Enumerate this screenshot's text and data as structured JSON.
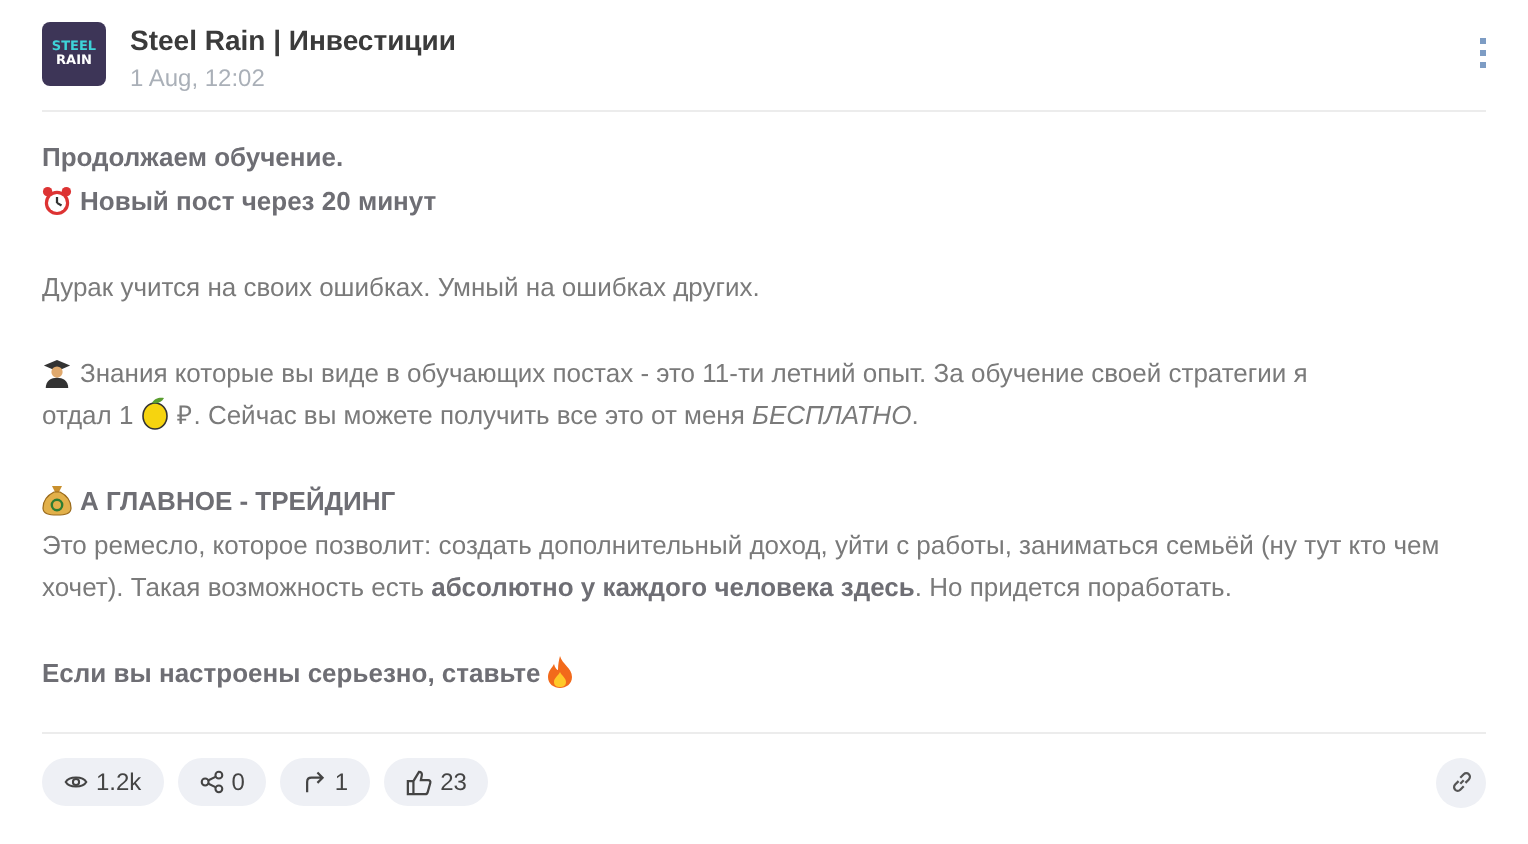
{
  "channel": {
    "avatar": {
      "lines": [
        "STEEL",
        "RAIN"
      ]
    },
    "title": "Steel Rain | Инвестиции",
    "date": "1 Aug, 12:02"
  },
  "paragraphs": [
    {
      "lines": [
        {
          "bold": true,
          "parts": [
            {
              "kind": "text",
              "text": "Продолжаем обучение."
            }
          ]
        },
        {
          "bold": true,
          "parts": [
            {
              "kind": "clock"
            },
            {
              "kind": "text",
              "text": "Новый пост через 20 минут"
            }
          ]
        }
      ]
    },
    {
      "lines": [
        {
          "bold": false,
          "parts": [
            {
              "kind": "text",
              "text": "Дурак учится на своих ошибках. Умный на ошибках других."
            }
          ]
        }
      ]
    },
    {
      "lines": [
        {
          "bold": false,
          "parts": [
            {
              "kind": "scholar"
            },
            {
              "kind": "text",
              "text": "Знания которые вы виде в обучающих постах - это 11-ти летний опыт. За обучение своей стратегии я"
            }
          ]
        },
        {
          "bold": false,
          "parts": [
            {
              "kind": "text",
              "text": "отдал 1"
            },
            {
              "kind": "lemon"
            },
            {
              "kind": "text",
              "text": "₽. Сейчас вы можете получить все это от меня *БЕСПЛАТНО*."
            }
          ]
        }
      ]
    },
    {
      "lines": [
        {
          "bold": true,
          "parts": [
            {
              "kind": "moneybag"
            },
            {
              "kind": "text",
              "text": "А ГЛАВНОЕ - ТРЕЙДИНГ"
            }
          ]
        },
        {
          "bold": false,
          "parts": [
            {
              "kind": "text",
              "text": "Это ремесло, которое позволит: создать дополнительный доход, уйти с работы, заниматься семьёй (ну тут кто чем хочет). Такая возможность есть **абсолютно у каждого человека здесь**. Но придется поработать."
            }
          ]
        }
      ]
    },
    {
      "lines": [
        {
          "bold": true,
          "parts": [
            {
              "kind": "text",
              "text": "Если вы настроены серьезно, ставьте"
            },
            {
              "kind": "fire"
            }
          ]
        }
      ]
    }
  ],
  "stats": [
    {
      "kind": "views",
      "text": "1.2k"
    },
    {
      "kind": "shares",
      "text": "0"
    },
    {
      "kind": "forwards",
      "text": "1"
    },
    {
      "kind": "likes",
      "text": "23"
    }
  ]
}
